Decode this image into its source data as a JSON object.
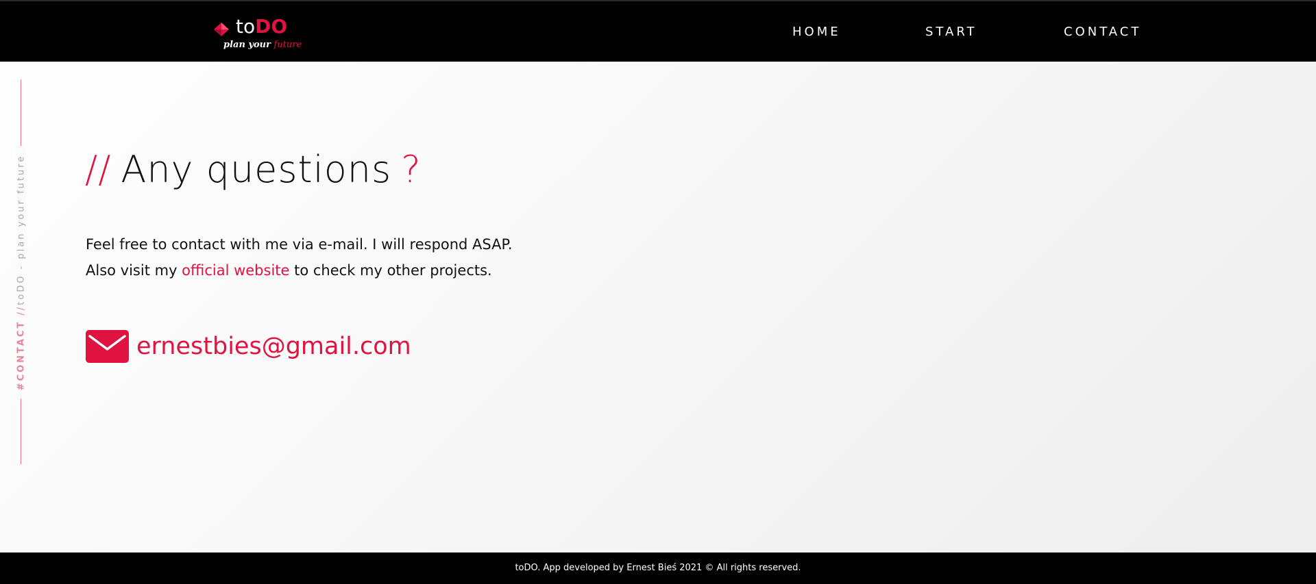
{
  "brand": {
    "name_prefix": "to",
    "name_accent": "DO",
    "tagline_prefix": "plan your ",
    "tagline_accent": "future",
    "accent_color": "#e0123f"
  },
  "nav": {
    "items": [
      {
        "label": "HOME"
      },
      {
        "label": "START"
      },
      {
        "label": "CONTACT"
      }
    ]
  },
  "side": {
    "section": "#CONTACT",
    "slashes": "//",
    "site": "toDO - plan your future"
  },
  "main": {
    "heading_prefix": "//",
    "heading": "Any questions",
    "heading_suffix": "?",
    "line1": "Feel free to contact with me via e-mail. I will respond ASAP.",
    "line2_before": "Also visit my ",
    "line2_link": "official website",
    "line2_after": " to check my other projects.",
    "email": "ernestbies@gmail.com",
    "email_icon": "envelope-icon"
  },
  "footer": {
    "text": "toDO. App developed by Ernest Bieś 2021 © All rights reserved."
  }
}
